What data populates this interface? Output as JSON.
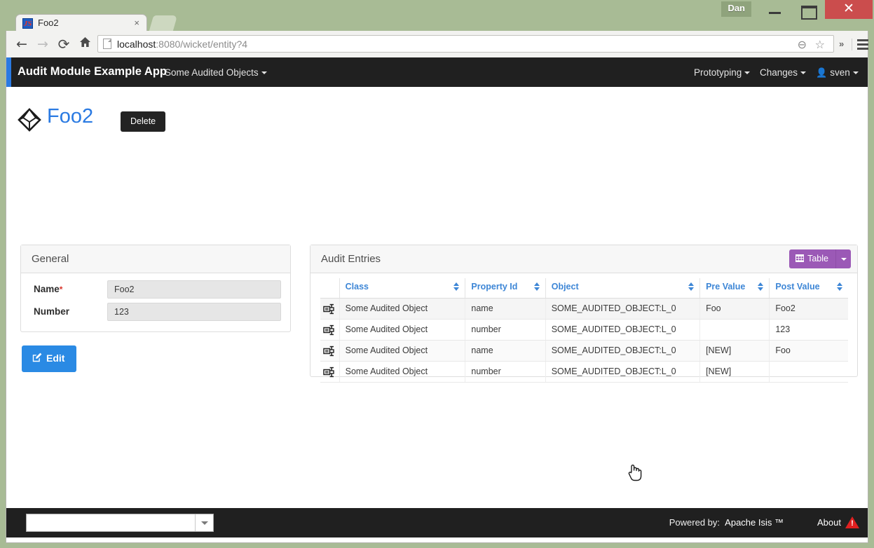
{
  "browser": {
    "window_user_badge": "Dan",
    "minimize_label": "Minimize",
    "maximize_label": "Maximize",
    "close_label": "✕",
    "tab": {
      "title": "Foo2",
      "close_label": "×",
      "favicon_name": "wicket-favicon"
    },
    "toolbar": {
      "back_glyph": "←",
      "forward_glyph": "→",
      "reload_glyph": "⟳",
      "home_glyph": "⌂",
      "url_host": "localhost",
      "url_path": ":8080/wicket/entity?4",
      "zoom_glyph": "⊖",
      "bookmark_glyph": "☆",
      "overflow_glyph": "»"
    }
  },
  "navbar": {
    "brand": "Audit Module Example App",
    "accent_color": "#2a7ae2",
    "background_color": "#202020",
    "left_items": [
      {
        "label": "Some Audited Objects",
        "has_caret": true
      }
    ],
    "right_items": [
      {
        "label": "Prototyping",
        "has_caret": true
      },
      {
        "label": "Changes",
        "has_caret": true
      },
      {
        "label": "sven",
        "has_caret": true,
        "icon": "user-icon",
        "glyph": "👤"
      }
    ]
  },
  "page": {
    "title": "Foo2",
    "title_color": "#2a7ae2",
    "entity_icon": "octahedron-entity-icon",
    "delete_button": "Delete"
  },
  "general_panel": {
    "title": "General",
    "fields": [
      {
        "label": "Name",
        "required": true,
        "value": "Foo2"
      },
      {
        "label": "Number",
        "required": false,
        "value": "123"
      }
    ],
    "edit_button": "Edit",
    "edit_icon_glyph": "✎"
  },
  "audit_panel": {
    "title": "Audit Entries",
    "view_button": {
      "label": "Table",
      "icon": "grid-icon",
      "icon_glyph": "▓",
      "color": "#9b59b6",
      "caret": true
    },
    "columns": [
      {
        "label": "",
        "sortable": false,
        "key": "icon"
      },
      {
        "label": "Class",
        "sortable": true,
        "key": "class"
      },
      {
        "label": "Property Id",
        "sortable": true,
        "key": "property_id"
      },
      {
        "label": "Object",
        "sortable": true,
        "key": "object"
      },
      {
        "label": "Pre Value",
        "sortable": true,
        "key": "pre_value"
      },
      {
        "label": "Post Value",
        "sortable": true,
        "key": "post_value"
      }
    ],
    "rows": [
      {
        "icon": "audit-entry-icon",
        "class": "Some Audited Object",
        "property_id": "name",
        "object": "SOME_AUDITED_OBJECT:L_0",
        "pre_value": "Foo",
        "post_value": "Foo2",
        "hovered": true
      },
      {
        "icon": "audit-entry-icon",
        "class": "Some Audited Object",
        "property_id": "number",
        "object": "SOME_AUDITED_OBJECT:L_0",
        "pre_value": "",
        "post_value": "123",
        "hovered": false
      },
      {
        "icon": "audit-entry-icon",
        "class": "Some Audited Object",
        "property_id": "name",
        "object": "SOME_AUDITED_OBJECT:L_0",
        "pre_value": "[NEW]",
        "post_value": "Foo",
        "hovered": false
      },
      {
        "icon": "audit-entry-icon",
        "class": "Some Audited Object",
        "property_id": "number",
        "object": "SOME_AUDITED_OBJECT:L_0",
        "pre_value": "[NEW]",
        "post_value": "",
        "hovered": false
      }
    ]
  },
  "footer": {
    "search_value": "",
    "search_placeholder": "",
    "powered_by_label": "Powered by:",
    "product_name": "Apache Isis ™",
    "about_label": "About",
    "warning_glyph": "!"
  }
}
